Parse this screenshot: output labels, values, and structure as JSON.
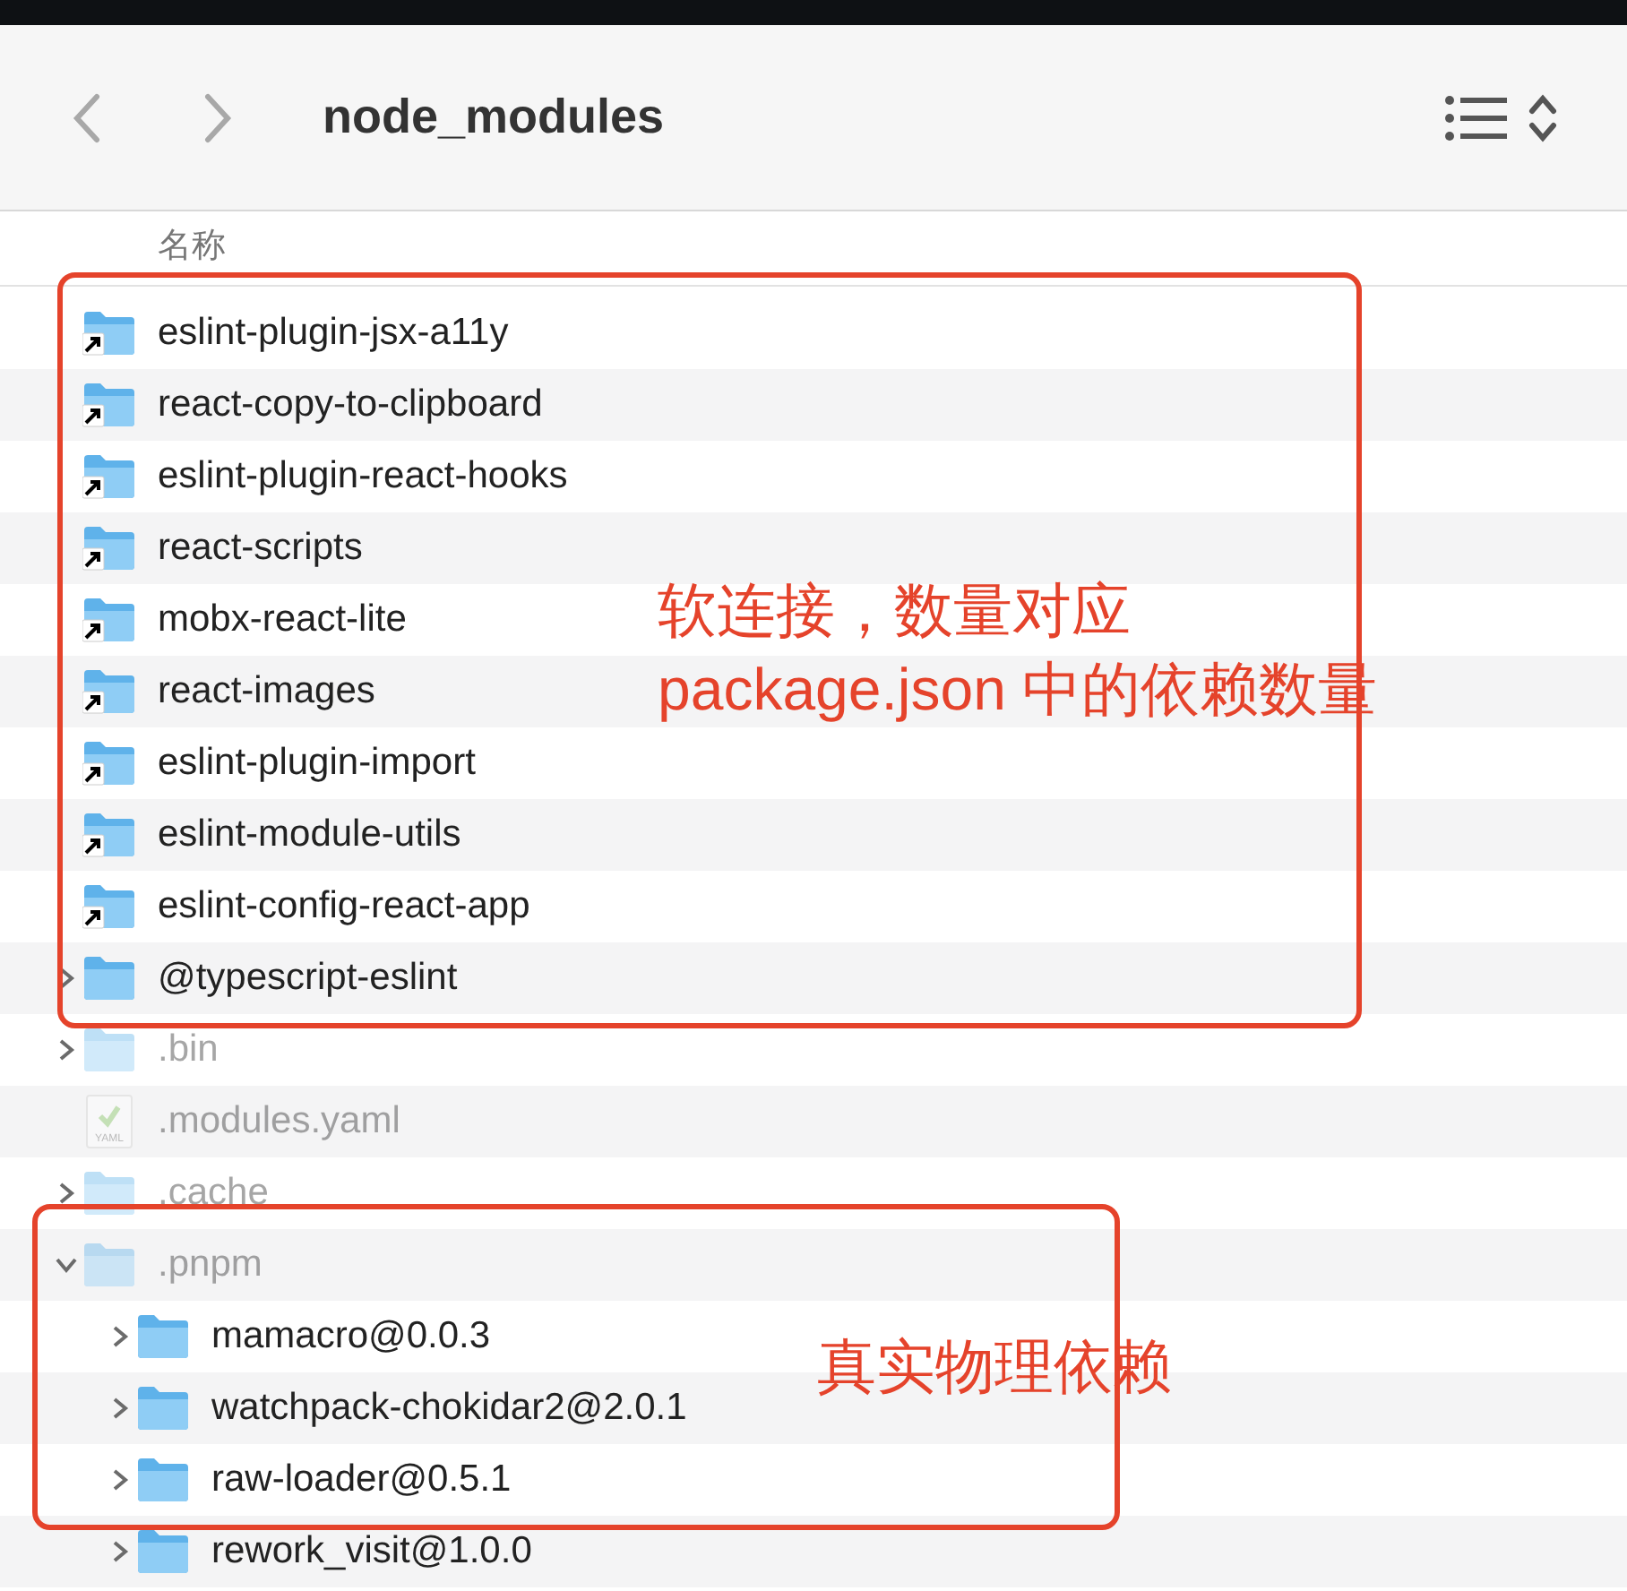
{
  "window": {
    "title": "node_modules"
  },
  "column_header": "名称",
  "rows": [
    {
      "name": "eslint-plugin-jsx-a11y",
      "kind": "folder",
      "alias": true,
      "hidden": false
    },
    {
      "name": "react-copy-to-clipboard",
      "kind": "folder",
      "alias": true,
      "hidden": false
    },
    {
      "name": "eslint-plugin-react-hooks",
      "kind": "folder",
      "alias": true,
      "hidden": false
    },
    {
      "name": "react-scripts",
      "kind": "folder",
      "alias": true,
      "hidden": false
    },
    {
      "name": "mobx-react-lite",
      "kind": "folder",
      "alias": true,
      "hidden": false
    },
    {
      "name": "react-images",
      "kind": "folder",
      "alias": true,
      "hidden": false
    },
    {
      "name": "eslint-plugin-import",
      "kind": "folder",
      "alias": true,
      "hidden": false
    },
    {
      "name": "eslint-module-utils",
      "kind": "folder",
      "alias": true,
      "hidden": false
    },
    {
      "name": "eslint-config-react-app",
      "kind": "folder",
      "alias": true,
      "hidden": false
    },
    {
      "name": "@typescript-eslint",
      "kind": "folder",
      "alias": false,
      "hidden": false,
      "expanded": false
    },
    {
      "name": ".bin",
      "kind": "folder",
      "alias": false,
      "hidden": true,
      "expanded": false
    },
    {
      "name": ".modules.yaml",
      "kind": "file",
      "icon_label": "YAML",
      "hidden": true
    },
    {
      "name": ".cache",
      "kind": "folder",
      "alias": false,
      "hidden": true,
      "expanded": false
    },
    {
      "name": ".pnpm",
      "kind": "folder",
      "alias": false,
      "hidden": true,
      "expanded": true,
      "children": [
        {
          "name": "mamacro@0.0.3",
          "kind": "folder",
          "alias": false,
          "hidden": false,
          "expanded": false
        },
        {
          "name": "watchpack-chokidar2@2.0.1",
          "kind": "folder",
          "alias": false,
          "hidden": false,
          "expanded": false
        },
        {
          "name": "raw-loader@0.5.1",
          "kind": "folder",
          "alias": false,
          "hidden": false,
          "expanded": false
        },
        {
          "name": "rework_visit@1.0.0",
          "kind": "folder",
          "alias": false,
          "hidden": false,
          "expanded": false
        }
      ]
    }
  ],
  "annotations": [
    {
      "lines": [
        "软连接，数量对应",
        "package.json 中的依赖数量"
      ]
    },
    {
      "lines": [
        "真实物理依赖"
      ]
    }
  ]
}
